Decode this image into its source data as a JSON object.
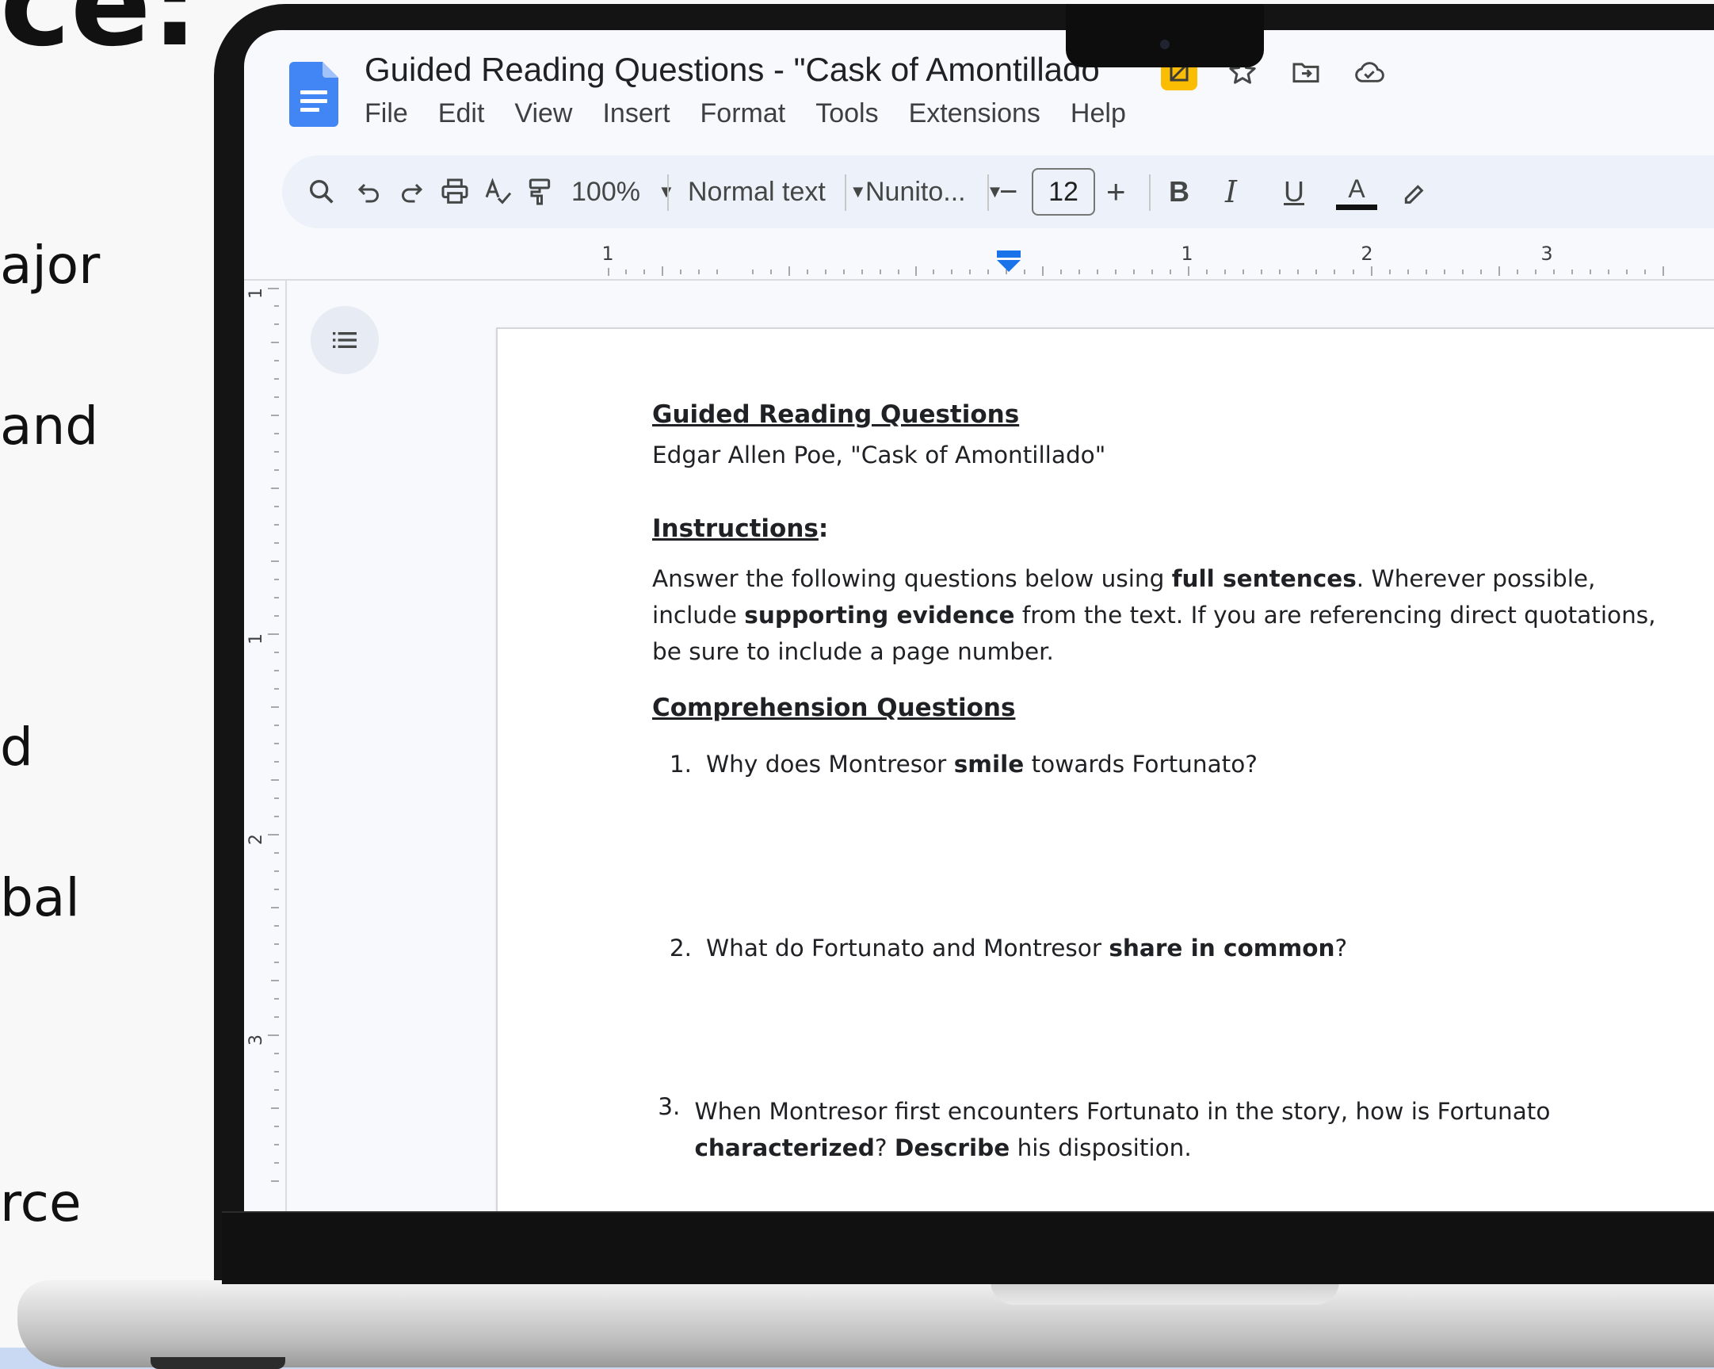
{
  "slide": {
    "title_fragment": "ce:",
    "fragments": [
      "ajor",
      "and",
      "d",
      "bal",
      "rce"
    ]
  },
  "doc": {
    "title": "Guided Reading Questions - \"Cask of Amontillado",
    "menu": [
      "File",
      "Edit",
      "View",
      "Insert",
      "Format",
      "Tools",
      "Extensions",
      "Help"
    ],
    "title_icons": [
      "not-shared-icon",
      "star-icon",
      "move-to-folder-icon",
      "cloud-saved-icon"
    ]
  },
  "toolbar": {
    "zoom": "100%",
    "style": "Normal text",
    "font": "Nunito...",
    "font_size": "12",
    "minus": "−",
    "plus": "+",
    "bold": "B",
    "italic": "I",
    "underline": "U",
    "text_color": "A"
  },
  "ruler": {
    "labels": [
      "1",
      "1",
      "2",
      "3"
    ],
    "vertical_labels": [
      "1",
      "1",
      "2",
      "3"
    ]
  },
  "page": {
    "heading": "Guided Reading Questions",
    "subtitle": "Edgar Allen Poe, \"Cask of Amontillado\"",
    "instructions_heading": "Instructions",
    "instructions_colon": ":",
    "instructions": {
      "p1": "Answer the following questions below using ",
      "b1": "full sentences",
      "p2": ". Wherever possible, include ",
      "b2": "supporting evidence",
      "p3": " from the text. If you are referencing direct quotations, be sure to include a page number."
    },
    "comprehension_heading": "Comprehension Questions",
    "questions": [
      {
        "num": "1.",
        "pre": "Why does Montresor ",
        "bold": "smile",
        "post": " towards Fortunato?"
      },
      {
        "num": "2.",
        "pre": "What do Fortunato and Montresor ",
        "bold": "share in common",
        "post": "?"
      },
      {
        "num": "3.",
        "pre": "When Montresor first encounters Fortunato in the story, how is Fortunato ",
        "bold": "characterized",
        "post": "? ",
        "bold2": "Describe",
        "post2": " his disposition."
      }
    ]
  },
  "colors": {
    "docs_blue": "#4285f4",
    "toolbar_bg": "#edf2fa",
    "bezel": "#141414",
    "accent_band": "#c9d8f3"
  }
}
